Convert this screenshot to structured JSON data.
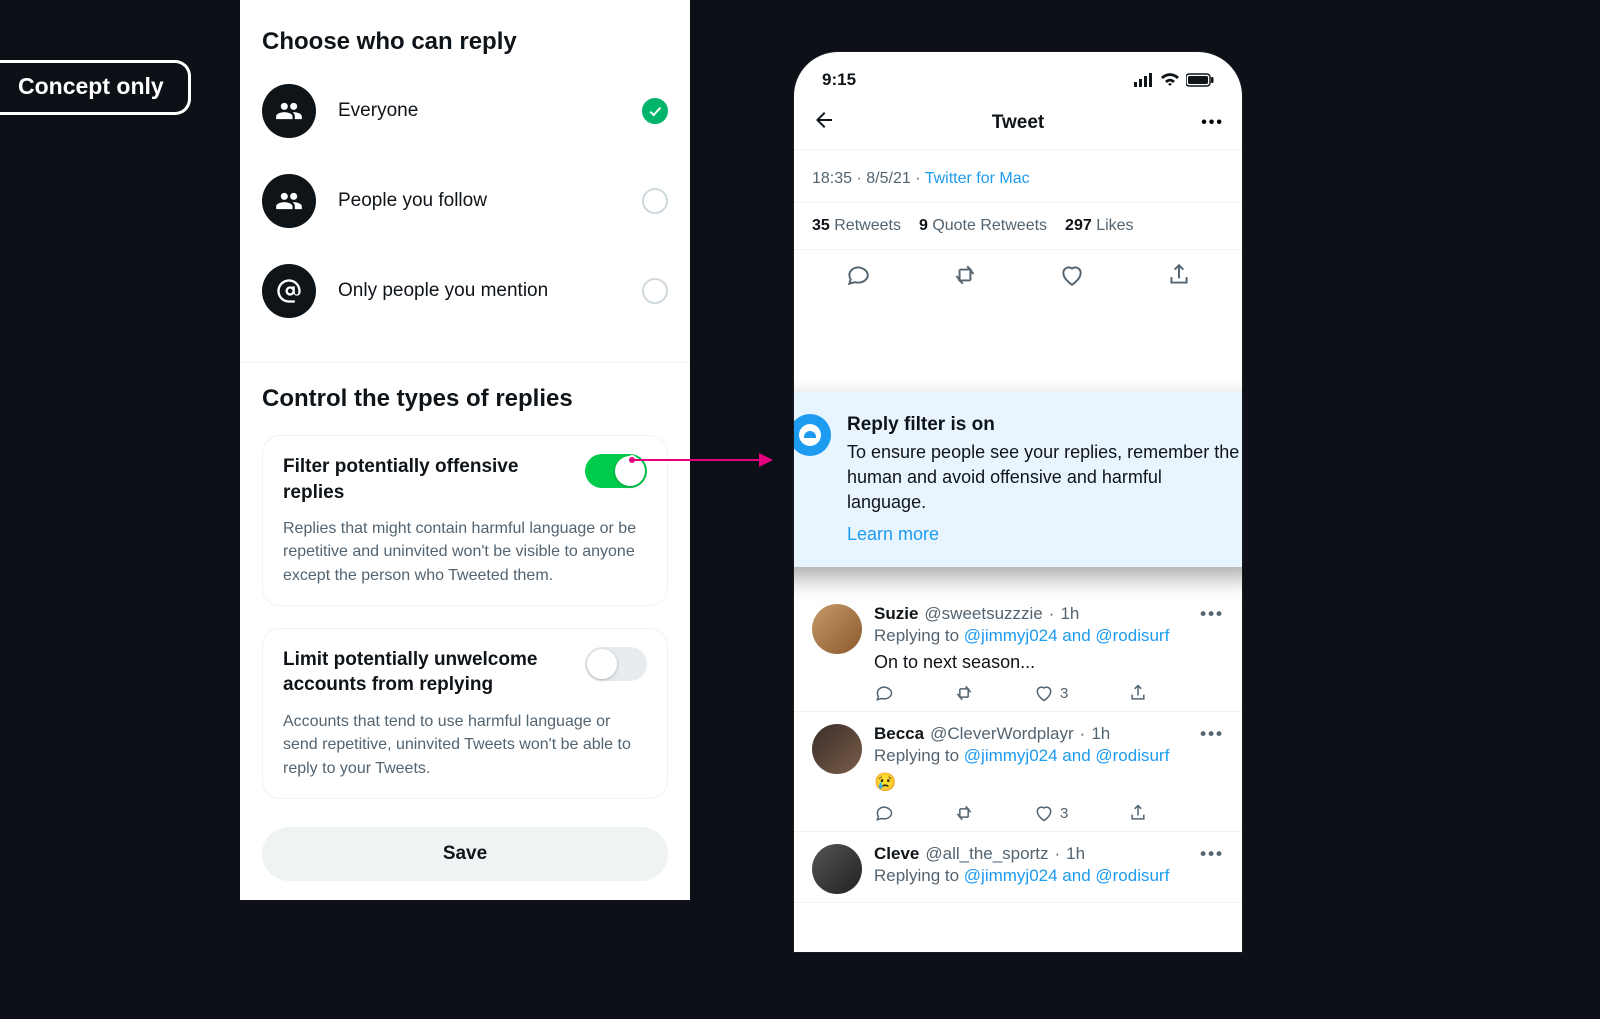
{
  "badge": "Concept only",
  "settings": {
    "who_title": "Choose who can reply",
    "options": [
      {
        "label": "Everyone",
        "selected": true,
        "icon": "group"
      },
      {
        "label": "People you follow",
        "selected": false,
        "icon": "group"
      },
      {
        "label": "Only people you mention",
        "selected": false,
        "icon": "at"
      }
    ],
    "control_title": "Control the types of replies",
    "card1": {
      "title": "Filter potentially offensive replies",
      "desc": "Replies that might contain harmful language or be repetitive and uninvited won't be visible to anyone except the person who Tweeted them.",
      "on": true
    },
    "card2": {
      "title": "Limit potentially unwelcome accounts from replying",
      "desc": "Accounts that tend to use harmful language or send repetitive, uninvited Tweets won't be able to reply to your Tweets.",
      "on": false
    },
    "save": "Save"
  },
  "phone": {
    "time": "9:15",
    "header_title": "Tweet",
    "meta": {
      "time": "18:35",
      "date": "8/5/21",
      "source": "Twitter for Mac"
    },
    "stats": {
      "retweets": "35",
      "retweets_label": "Retweets",
      "quotes": "9",
      "quotes_label": "Quote Retweets",
      "likes": "297",
      "likes_label": "Likes"
    },
    "filter": {
      "title": "Reply filter is on",
      "desc": "To ensure people see your replies, remember the human and avoid offensive and harmful language.",
      "learn": "Learn more"
    },
    "replies": [
      {
        "name": "Suzie",
        "handle": "@sweetsuzzzie",
        "time": "1h",
        "replying_prefix": "Replying to ",
        "mentions": "@jimmyj024 and @rodisurf",
        "text": "On to next season...",
        "likes": "3"
      },
      {
        "name": "Becca",
        "handle": "@CleverWordplayr",
        "time": "1h",
        "replying_prefix": "Replying to ",
        "mentions": "@jimmyj024 and @rodisurf",
        "text": "😢",
        "likes": "3"
      },
      {
        "name": "Cleve",
        "handle": "@all_the_sportz",
        "time": "1h",
        "replying_prefix": "Replying to ",
        "mentions": "@jimmyj024 and @rodisurf",
        "text": "",
        "likes": ""
      }
    ]
  }
}
